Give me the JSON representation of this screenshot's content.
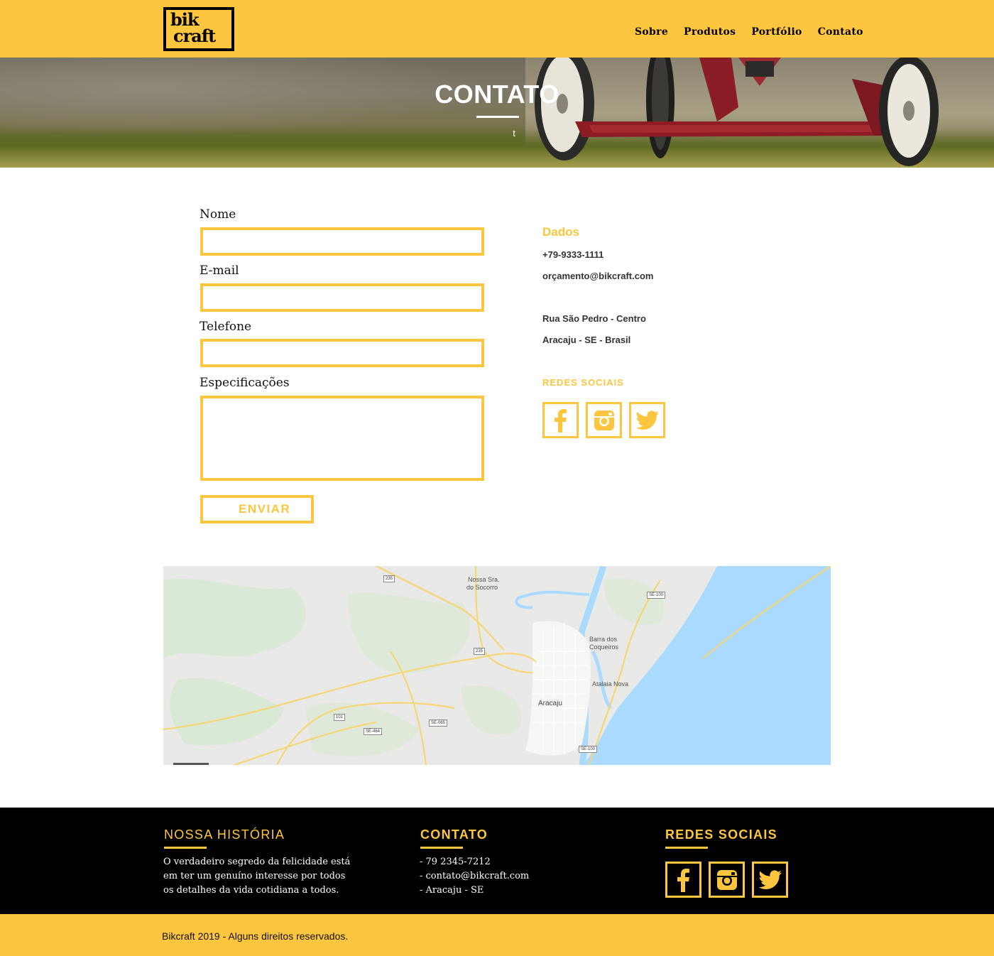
{
  "header": {
    "logo_line1": "bik",
    "logo_line2": "craft",
    "nav": [
      "Sobre",
      "Produtos",
      "Portfólio",
      "Contato"
    ]
  },
  "hero": {
    "title": "CONTATO",
    "subtitle": "t"
  },
  "form": {
    "name_label": "Nome",
    "email_label": "E-mail",
    "phone_label": "Telefone",
    "specs_label": "Especificações",
    "submit_label": "ENVIAR"
  },
  "dados": {
    "title": "Dados",
    "phone": "+79-9333-1111",
    "email": "orçamento@bikcraft.com",
    "address_line1": "Rua São Pedro - Centro",
    "address_line2": "Aracaju - SE - Brasil",
    "social_title": "REDES SOCIAIS"
  },
  "map": {
    "labels": {
      "socorro_1": "Nossa Sra.",
      "socorro_2": "do Socorro",
      "barra_1": "Barra dos",
      "barra_2": "Coqueiros",
      "atalaia": "Atalaia Nova",
      "aracaju": "Aracaju"
    },
    "roads": [
      "235",
      "235",
      "SE-100",
      "101",
      "SE-464",
      "SE-065",
      "SE-100"
    ]
  },
  "footer": {
    "history_title": "NOSSA HISTÓRIA",
    "history_text_1": "O verdadeiro segredo da felicidade está",
    "history_text_2": "em ter um genuíno interesse por todos",
    "history_text_3": "os detalhes da vida cotidiana a todos.",
    "contact_title": "CONTATO",
    "contact_phone": "- 79 2345-7212",
    "contact_email": "- contato@bikcraft.com",
    "contact_city": "- Aracaju - SE",
    "social_title": "REDES SOCIAIS",
    "copyright": "Bikcraft 2019 - Alguns direitos reservados."
  },
  "colors": {
    "accent": "#fec63e",
    "footer_bg": "#000000",
    "sea": "#aadaff"
  }
}
